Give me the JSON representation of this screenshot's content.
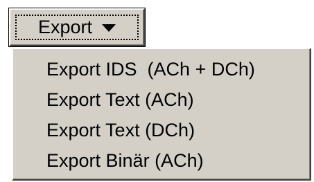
{
  "export_button": {
    "label": "Export",
    "icon": "chevron-down-icon"
  },
  "menu": {
    "items": [
      {
        "label": "Export IDS  (ACh + DCh)"
      },
      {
        "label": "Export Text (ACh)"
      },
      {
        "label": "Export Text (DCh)"
      },
      {
        "label": "Export Binär (ACh)"
      }
    ]
  },
  "colors": {
    "face": "#d4d0c8",
    "highlight": "#ffffff",
    "shadow": "#404040",
    "text": "#000000"
  }
}
